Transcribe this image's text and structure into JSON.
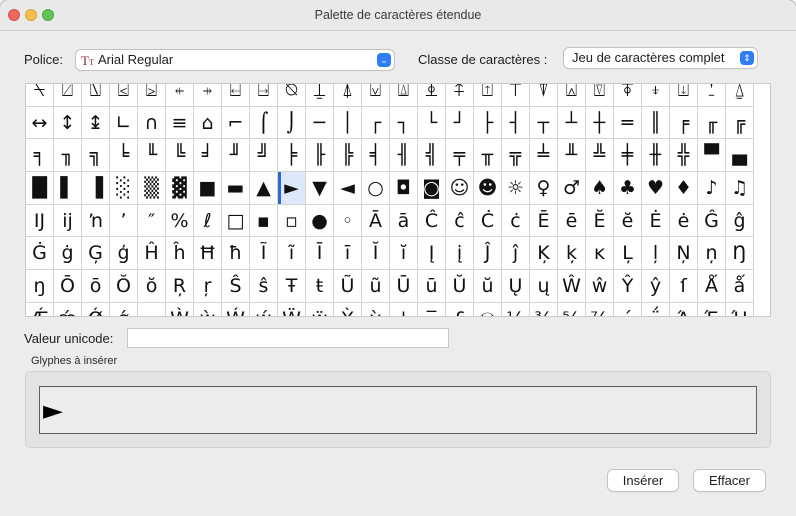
{
  "window": {
    "title": "Palette de caractères étendue"
  },
  "font": {
    "label": "Police:",
    "value": "Arial Regular"
  },
  "charclass": {
    "label": "Classe de caractères :",
    "value": "Jeu de caractères complet"
  },
  "grid": {
    "rows": [
      [
        "⍀",
        "⍁",
        "⍂",
        "⍃",
        "⍄",
        "⍅",
        "⍆",
        "⍇",
        "⍈",
        "⍉",
        "⍊",
        "⍋",
        "⍌",
        "⍍",
        "⍎",
        "⍏",
        "⍐",
        "⍑",
        "⍒",
        "⍓",
        "⍔",
        "⍕",
        "⍖",
        "⍗",
        "⍘",
        "⍙"
      ],
      [
        "↔",
        "↕",
        "↨",
        "∟",
        "∩",
        "≡",
        "⌂",
        "⌐",
        "⌠",
        "⌡",
        "─",
        "│",
        "┌",
        "┐",
        "└",
        "┘",
        "├",
        "┤",
        "┬",
        "┴",
        "┼",
        "═",
        "║",
        "╒",
        "╓",
        "╔"
      ],
      [
        "╕",
        "╖",
        "╗",
        "╘",
        "╙",
        "╚",
        "╛",
        "╜",
        "╝",
        "╞",
        "╟",
        "╠",
        "╡",
        "╢",
        "╣",
        "╤",
        "╥",
        "╦",
        "╧",
        "╨",
        "╩",
        "╪",
        "╫",
        "╬",
        "▀",
        "▄"
      ],
      [
        "█",
        "▌",
        "▐",
        "░",
        "▒",
        "▓",
        "■",
        "▬",
        "▲",
        "►",
        "▼",
        "◄",
        "○",
        "◘",
        "◙",
        "☺",
        "☻",
        "☼",
        "♀",
        "♂",
        "♠",
        "♣",
        "♥",
        "♦",
        "♪",
        "♫"
      ],
      [
        "Ĳ",
        "ĳ",
        "ŉ",
        "ʼ",
        "″",
        "%",
        "ℓ",
        "□",
        "▪",
        "▫",
        "●",
        "◦",
        "Ā",
        "ā",
        "Ĉ",
        "ĉ",
        "Ċ",
        "ċ",
        "Ē",
        "ē",
        "Ĕ",
        "ĕ",
        "Ė",
        "ė",
        "Ĝ",
        "ĝ"
      ],
      [
        "Ġ",
        "ġ",
        "Ģ",
        "ģ",
        "Ĥ",
        "ĥ",
        "Ħ",
        "ħ",
        "Ĩ",
        "ĩ",
        "Ī",
        "ī",
        "Ĭ",
        "ĭ",
        "Į",
        "į",
        "Ĵ",
        "ĵ",
        "Ķ",
        "ķ",
        "ĸ",
        "Ļ",
        "ļ",
        "Ņ",
        "ņ",
        "Ŋ"
      ],
      [
        "ŋ",
        "Ō",
        "ō",
        "Ŏ",
        "ŏ",
        "Ŗ",
        "ŗ",
        "Ŝ",
        "ŝ",
        "Ŧ",
        "ŧ",
        "Ũ",
        "ũ",
        "Ū",
        "ū",
        "Ŭ",
        "ŭ",
        "Ų",
        "ų",
        "Ŵ",
        "ŵ",
        "Ŷ",
        "ŷ",
        "ſ",
        "Ǻ",
        "ǻ"
      ],
      [
        "Ǽ",
        "ǽ",
        "Ǿ",
        "ǿ",
        "·",
        "Ẁ",
        "ẁ",
        "Ẃ",
        "ẃ",
        "Ẅ",
        "ẅ",
        "Ỳ",
        "ỳ",
        "'",
        "‾",
        "£",
        "℮",
        "⅛",
        "⅜",
        "⅝",
        "⅞",
        "΄",
        "΅",
        "Ά",
        "Έ",
        "Ή"
      ]
    ],
    "selected": {
      "row": 3,
      "col": 9
    }
  },
  "unicode": {
    "label": "Valeur unicode:",
    "value": ""
  },
  "glyphs": {
    "label": "Glyphes à insérer",
    "value": "►"
  },
  "buttons": {
    "insert": "Insérer",
    "clear": "Effacer"
  },
  "colors": {
    "accent": "#2e7cf6",
    "selection": "#dde8fb"
  }
}
